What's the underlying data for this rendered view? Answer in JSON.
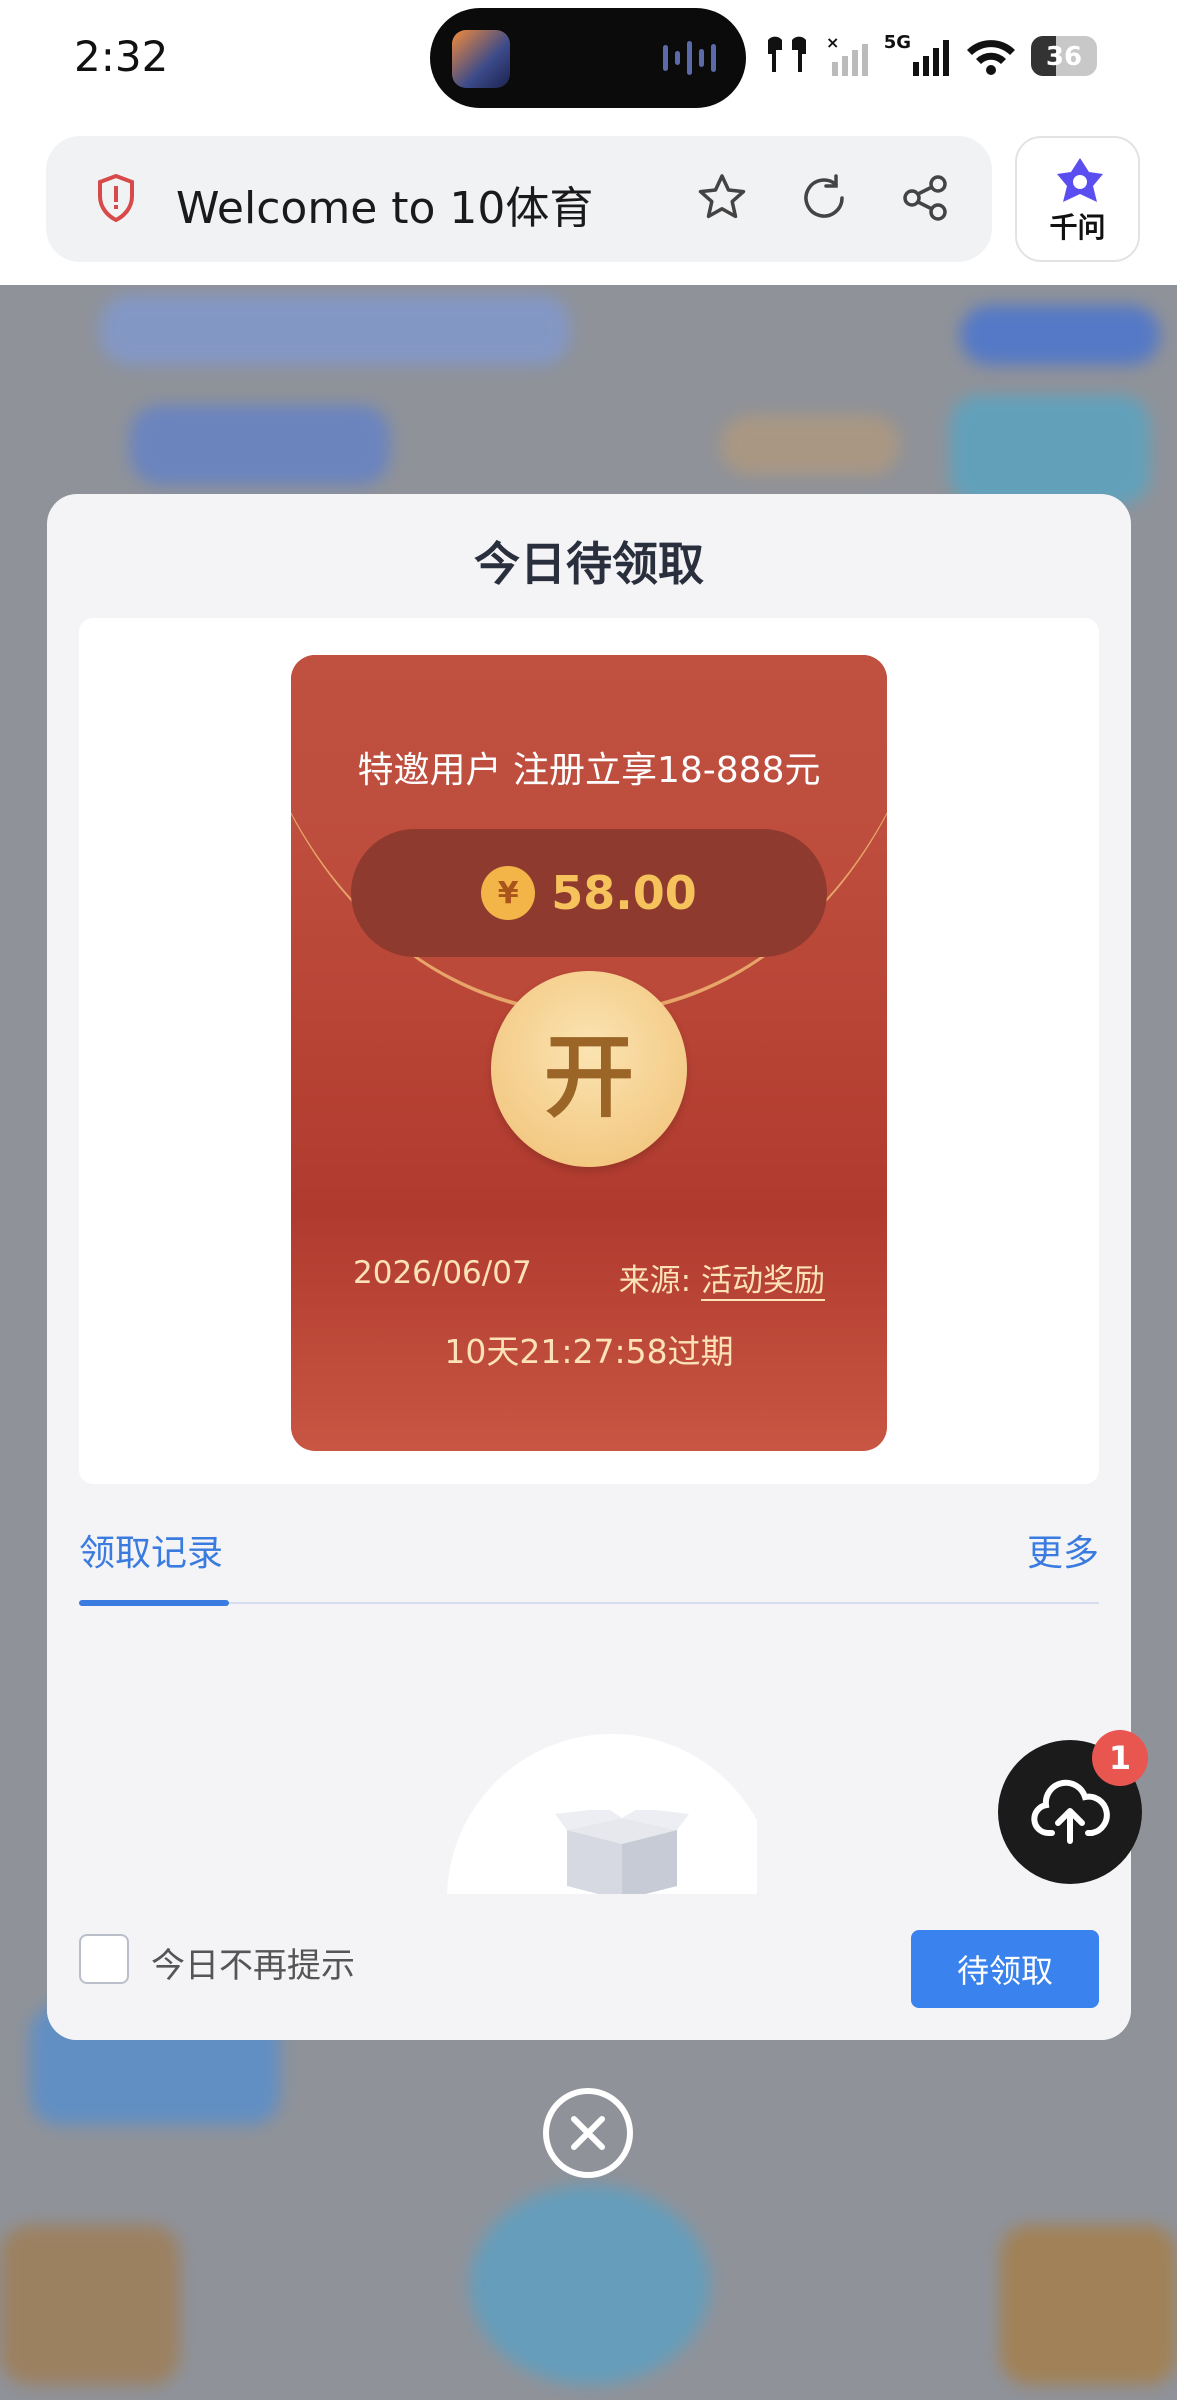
{
  "status_bar": {
    "time": "2:32",
    "network": "5G",
    "battery": "36"
  },
  "browser": {
    "page_title": "Welcome to 10体育",
    "assistant_label": "千问"
  },
  "modal": {
    "title": "今日待领取",
    "envelope": {
      "subtitle": "特邀用户 注册立享18-888元",
      "currency_symbol": "¥",
      "amount": "58.00",
      "open_label": "开",
      "date": "2026/06/07",
      "source_label": "来源:",
      "source_value": "活动奖励",
      "expiry": "10天21:27:58过期"
    },
    "tabs": {
      "active": "领取记录",
      "more": "更多"
    },
    "footer": {
      "dont_remind": "今日不再提示",
      "claim_button": "待领取"
    }
  },
  "fab": {
    "badge": "1"
  }
}
